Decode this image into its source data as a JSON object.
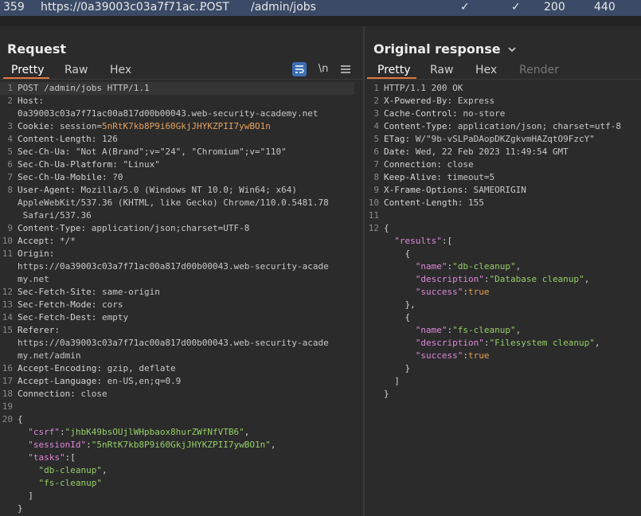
{
  "history": {
    "id": "359",
    "host": "https://0a39003c03a7f71ac...",
    "method": "POST",
    "path": "/admin/jobs",
    "check1": "✓",
    "check2": "✓",
    "status": "200",
    "length": "440"
  },
  "request": {
    "title": "Request",
    "tabs": [
      "Pretty",
      "Raw",
      "Hex"
    ],
    "newline_label": "\\n",
    "lines": [
      {
        "n": "1",
        "h": "POST /admin/jobs HTTP/1.1"
      },
      {
        "n": "2",
        "k": "Host",
        "v": ""
      },
      {
        "n": "",
        "h": "0a39003c03a7f71ac00a817d00b00043.web-security-academy.net"
      },
      {
        "n": "3",
        "k": "Cookie",
        "v": " session=",
        "cv": "5nRtK7kb8P9i60GkjJHYKZPII7ywBO1n"
      },
      {
        "n": "4",
        "k": "Content-Length",
        "v": " 126"
      },
      {
        "n": "5",
        "k": "Sec-Ch-Ua",
        "v": " \"Not A(Brand\";v=\"24\", \"Chromium\";v=\"110\""
      },
      {
        "n": "6",
        "k": "Sec-Ch-Ua-Platform",
        "v": " \"Linux\""
      },
      {
        "n": "7",
        "k": "Sec-Ch-Ua-Mobile",
        "v": " ?0"
      },
      {
        "n": "8",
        "k": "User-Agent",
        "v": " Mozilla/5.0 (Windows NT 10.0; Win64; x64)"
      },
      {
        "n": "",
        "h": "AppleWebKit/537.36 (KHTML, like Gecko) Chrome/110.0.5481.78"
      },
      {
        "n": "",
        "h": " Safari/537.36"
      },
      {
        "n": "9",
        "k": "Content-Type",
        "v": " application/json;charset=UTF-8"
      },
      {
        "n": "10",
        "k": "Accept",
        "v": " */*"
      },
      {
        "n": "11",
        "k": "Origin",
        "v": ""
      },
      {
        "n": "",
        "h": "https://0a39003c03a7f71ac00a817d00b00043.web-security-acade"
      },
      {
        "n": "",
        "h": "my.net"
      },
      {
        "n": "12",
        "k": "Sec-Fetch-Site",
        "v": " same-origin"
      },
      {
        "n": "13",
        "k": "Sec-Fetch-Mode",
        "v": " cors"
      },
      {
        "n": "14",
        "k": "Sec-Fetch-Dest",
        "v": " empty"
      },
      {
        "n": "15",
        "k": "Referer",
        "v": ""
      },
      {
        "n": "",
        "h": "https://0a39003c03a7f71ac00a817d00b00043.web-security-acade"
      },
      {
        "n": "",
        "h": "my.net/admin"
      },
      {
        "n": "16",
        "k": "Accept-Encoding",
        "v": " gzip, deflate"
      },
      {
        "n": "17",
        "k": "Accept-Language",
        "v": " en-US,en;q=0.9"
      },
      {
        "n": "18",
        "k": "Connection",
        "v": " close"
      },
      {
        "n": "19",
        "h": ""
      },
      {
        "n": "20",
        "p": "{"
      },
      {
        "n": "",
        "i": "  ",
        "jk": "\"csrf\"",
        "sep": ":",
        "js": "\"jhbK49bsOUjlWHpbaox8hurZWfNfVTB6\"",
        "tail": ","
      },
      {
        "n": "",
        "i": "  ",
        "jk": "\"sessionId\"",
        "sep": ":",
        "js": "\"5nRtK7kb8P9i60GkjJHYKZPII7ywBO1n\"",
        "tail": ","
      },
      {
        "n": "",
        "i": "  ",
        "jk": "\"tasks\"",
        "sep": ":["
      },
      {
        "n": "",
        "i": "    ",
        "js": "\"db-cleanup\"",
        "tail": ","
      },
      {
        "n": "",
        "i": "    ",
        "js": "\"fs-cleanup\""
      },
      {
        "n": "",
        "p": "  ]"
      },
      {
        "n": "",
        "p": "}"
      }
    ]
  },
  "response": {
    "title": "Original response",
    "tabs": [
      "Pretty",
      "Raw",
      "Hex",
      "Render"
    ],
    "lines": [
      {
        "n": "1",
        "h": "HTTP/1.1 200 OK"
      },
      {
        "n": "2",
        "k": "X-Powered-By",
        "v": " Express"
      },
      {
        "n": "3",
        "k": "Cache-Control",
        "v": " no-store"
      },
      {
        "n": "4",
        "k": "Content-Type",
        "v": " application/json; charset=utf-8"
      },
      {
        "n": "5",
        "k": "ETag",
        "v": " W/\"9b-vSLPaDAopDKZgkvmHAZqtO9FzcY\""
      },
      {
        "n": "6",
        "k": "Date",
        "v": " Wed, 22 Feb 2023 11:49:54 GMT"
      },
      {
        "n": "7",
        "k": "Connection",
        "v": " close"
      },
      {
        "n": "8",
        "k": "Keep-Alive",
        "v": " timeout=5"
      },
      {
        "n": "9",
        "k": "X-Frame-Options",
        "v": " SAMEORIGIN"
      },
      {
        "n": "10",
        "k": "Content-Length",
        "v": " 155"
      },
      {
        "n": "11",
        "h": ""
      },
      {
        "n": "12",
        "p": "{"
      },
      {
        "n": "",
        "i": "  ",
        "jk": "\"results\"",
        "sep": ":["
      },
      {
        "n": "",
        "p": "    {"
      },
      {
        "n": "",
        "i": "      ",
        "jk": "\"name\"",
        "sep": ":",
        "js": "\"db-cleanup\"",
        "tail": ","
      },
      {
        "n": "",
        "i": "      ",
        "jk": "\"description\"",
        "sep": ":",
        "js": "\"Database cleanup\"",
        "tail": ","
      },
      {
        "n": "",
        "i": "      ",
        "jk": "\"success\"",
        "sep": ":",
        "jb": "true"
      },
      {
        "n": "",
        "p": "    },"
      },
      {
        "n": "",
        "p": "    {"
      },
      {
        "n": "",
        "i": "      ",
        "jk": "\"name\"",
        "sep": ":",
        "js": "\"fs-cleanup\"",
        "tail": ","
      },
      {
        "n": "",
        "i": "      ",
        "jk": "\"description\"",
        "sep": ":",
        "js": "\"Filesystem cleanup\"",
        "tail": ","
      },
      {
        "n": "",
        "i": "      ",
        "jk": "\"success\"",
        "sep": ":",
        "jb": "true"
      },
      {
        "n": "",
        "p": "    }"
      },
      {
        "n": "",
        "p": "  ]"
      },
      {
        "n": "",
        "p": "}"
      }
    ]
  },
  "colors": {
    "accent": "#e0763b",
    "history_bg": "#3b4a66",
    "json_key": "#dd88d9",
    "json_string": "#95cf65",
    "json_bool": "#e6a050",
    "cookie_value": "#e5a25c"
  }
}
